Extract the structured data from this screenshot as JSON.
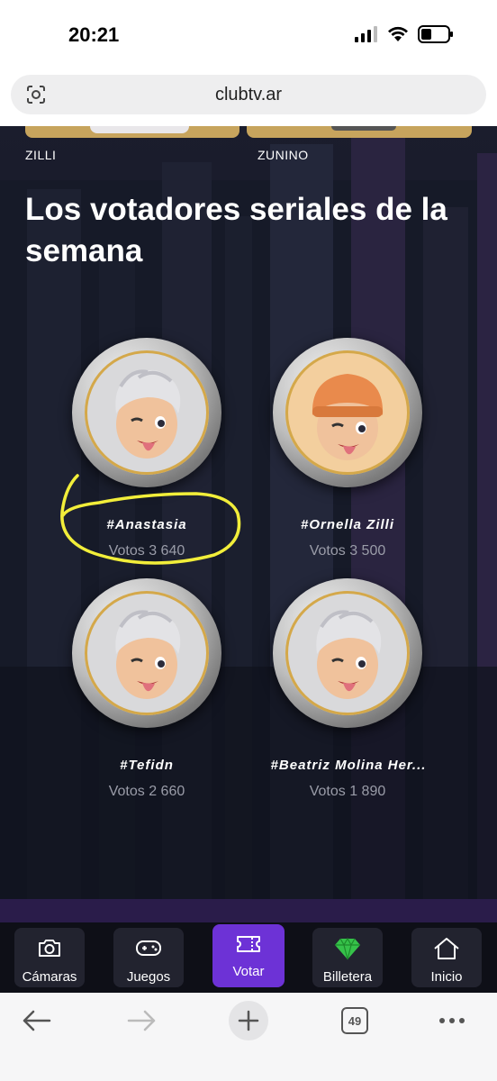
{
  "status": {
    "time": "20:21"
  },
  "browser": {
    "url": "clubtv.ar",
    "tab_count": "49"
  },
  "top_row": {
    "names": [
      "ZILLI",
      "ZUNINO"
    ]
  },
  "section": {
    "title": "Los votadores seriales de la semana"
  },
  "voters": [
    {
      "name": "#Anastasia",
      "votes": "Votos 3 640",
      "avatar": "memoji-silver-hair-icon"
    },
    {
      "name": "#Ornella Zilli",
      "votes": "Votos 3 500",
      "avatar": "memoji-orange-beanie-icon"
    },
    {
      "name": "#Tefidn",
      "votes": "Votos 2 660",
      "avatar": "memoji-silver-hair-icon"
    },
    {
      "name": "#Beatriz Molina Her...",
      "votes": "Votos 1 890",
      "avatar": "memoji-silver-hair-icon"
    }
  ],
  "nav": {
    "tabs": [
      {
        "label": "Cámaras",
        "icon": "camera-icon"
      },
      {
        "label": "Juegos",
        "icon": "gamepad-icon"
      },
      {
        "label": "Votar",
        "icon": "ticket-icon",
        "active": true
      },
      {
        "label": "Billetera",
        "icon": "gem-icon"
      },
      {
        "label": "Inicio",
        "icon": "home-icon"
      }
    ]
  },
  "colors": {
    "accent": "#6d32d6",
    "gold": "#d4a84a",
    "annotation": "#f2ee3a"
  }
}
